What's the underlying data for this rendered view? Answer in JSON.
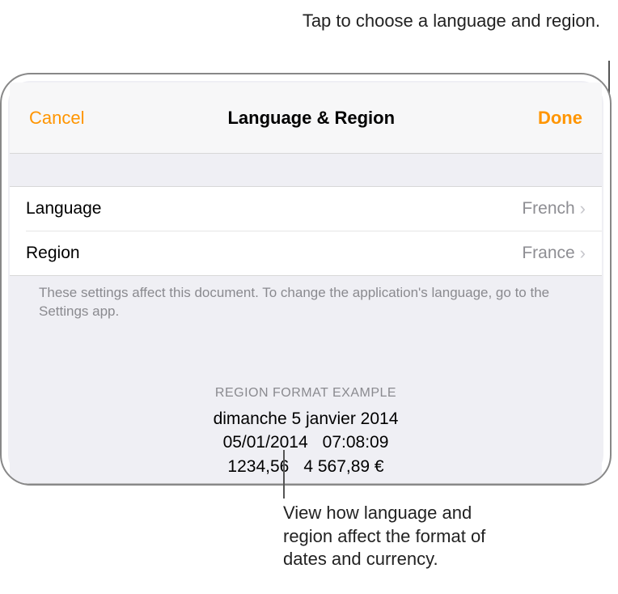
{
  "callouts": {
    "top": "Tap to choose a language and region.",
    "bottom": "View how language and region affect the format of dates and currency."
  },
  "navbar": {
    "cancel": "Cancel",
    "title": "Language & Region",
    "done": "Done"
  },
  "rows": {
    "language": {
      "label": "Language",
      "value": "French"
    },
    "region": {
      "label": "Region",
      "value": "France"
    }
  },
  "footer": "These settings affect this document. To change the application's language, go to the Settings app.",
  "example": {
    "header": "REGION FORMAT EXAMPLE",
    "line1": "dimanche 5 janvier 2014",
    "date_short": "05/01/2014",
    "time": "07:08:09",
    "number": "1234,56",
    "currency": "4 567,89 €"
  }
}
